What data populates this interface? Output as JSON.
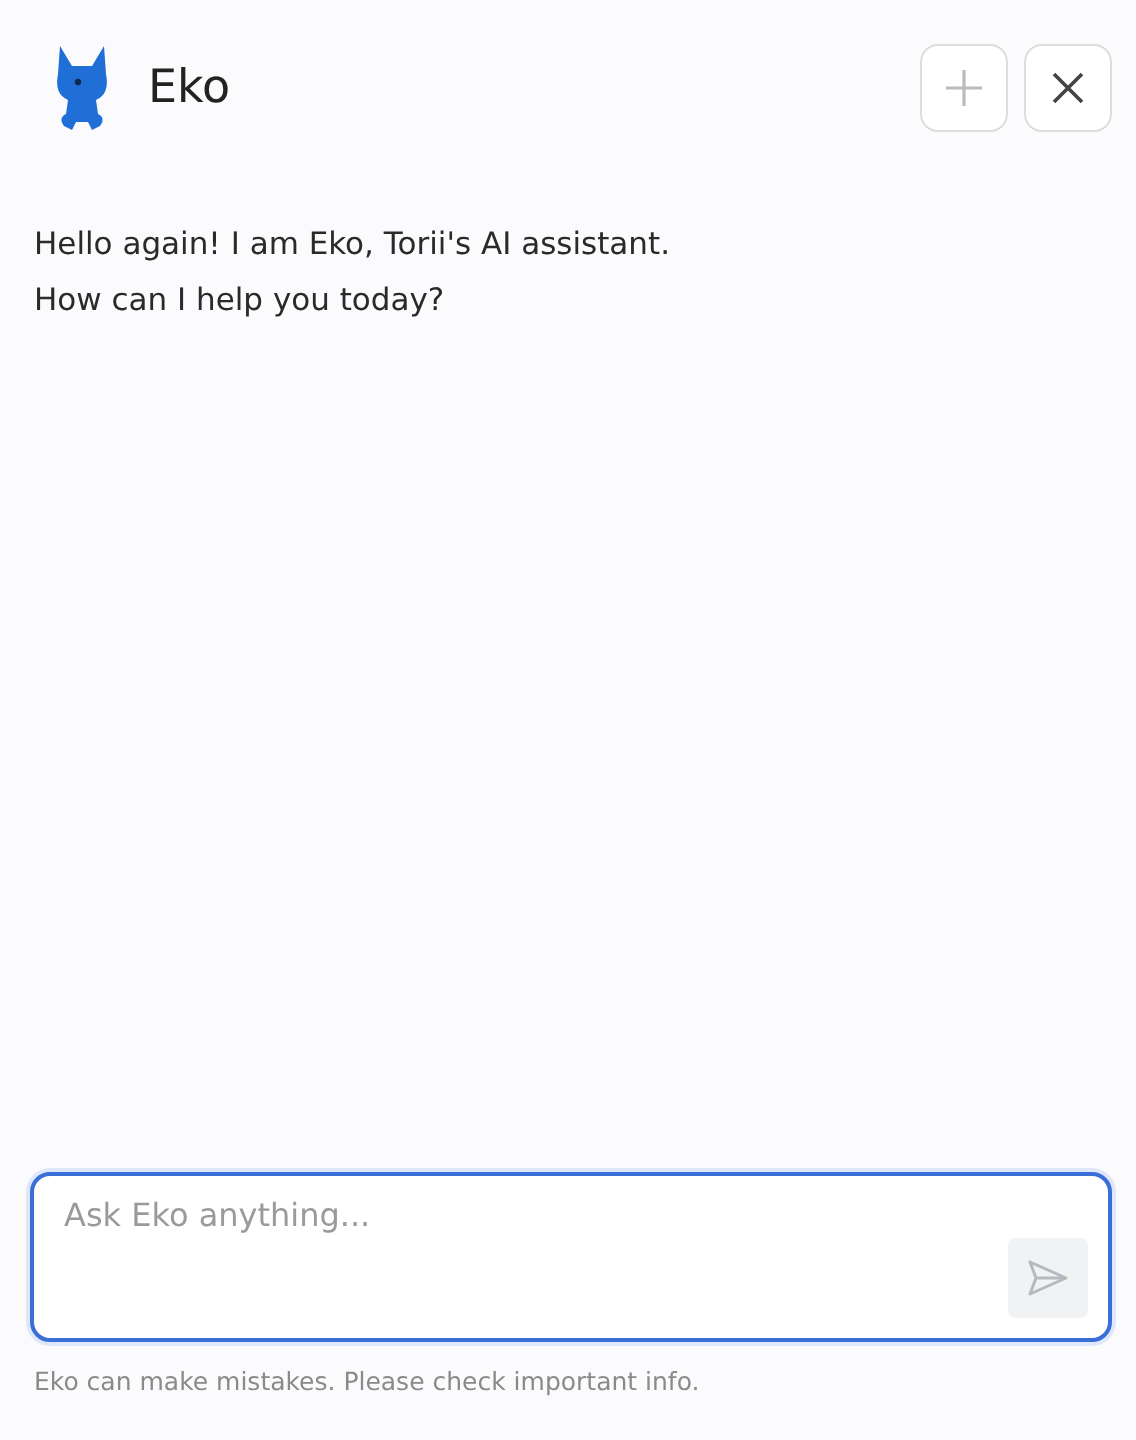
{
  "header": {
    "title": "Eko"
  },
  "message": {
    "lines": [
      "Hello again! I am Eko, Torii's AI assistant.",
      "How can I help you today?"
    ]
  },
  "composer": {
    "placeholder": "Ask Eko anything...",
    "send_disabled": true
  },
  "disclaimer": "Eko can make mistakes. Please check important info."
}
